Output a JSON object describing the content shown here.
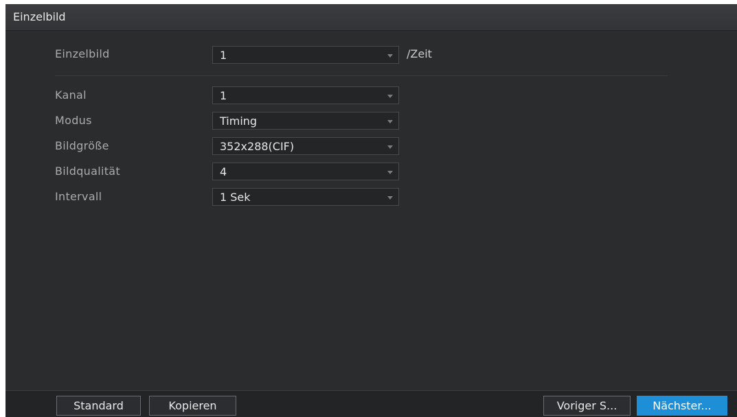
{
  "window": {
    "title": "Einzelbild"
  },
  "form": {
    "einzelbild": {
      "label": "Einzelbild",
      "value": "1",
      "suffix": "/Zeit"
    },
    "kanal": {
      "label": "Kanal",
      "value": "1"
    },
    "modus": {
      "label": "Modus",
      "value": "Timing"
    },
    "bildgroesse": {
      "label": "Bildgröße",
      "value": "352x288(CIF)"
    },
    "bildqualitaet": {
      "label": "Bildqualität",
      "value": "4"
    },
    "intervall": {
      "label": "Intervall",
      "value": "1 Sek"
    }
  },
  "footer": {
    "standard_label": "Standard",
    "kopieren_label": "Kopieren",
    "back_label": "Voriger S...",
    "next_label": "Nächster..."
  },
  "colors": {
    "background": "#2b2c2e",
    "primary_button": "#1e8fd6"
  },
  "icons": {
    "dropdown": "chevron-down-icon"
  }
}
